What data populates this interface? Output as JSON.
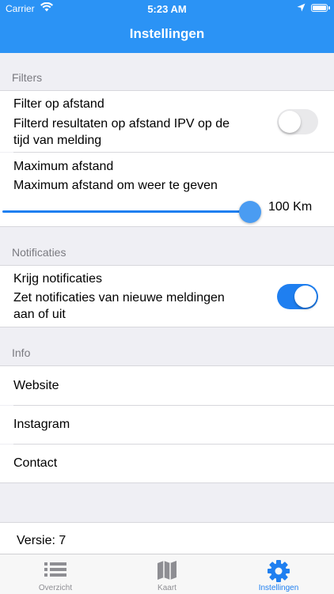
{
  "status_bar": {
    "carrier": "Carrier",
    "time": "5:23 AM"
  },
  "header": {
    "title": "Instellingen"
  },
  "filters": {
    "section_title": "Filters",
    "filter_distance": {
      "title": "Filter op afstand",
      "subtitle_line1": "Filterd resultaten op afstand IPV op de",
      "subtitle_line2": "tijd van melding",
      "enabled": false
    },
    "max_distance": {
      "title": "Maximum afstand",
      "subtitle": "Maximum afstand om weer te geven",
      "value_label": "100 Km",
      "slider_fraction": 1.0
    }
  },
  "notifications": {
    "section_title": "Notificaties",
    "receive": {
      "title": "Krijg notificaties",
      "subtitle_line1": "Zet notificaties van nieuwe meldingen",
      "subtitle_line2": "aan of uit",
      "enabled": true
    }
  },
  "info": {
    "section_title": "Info",
    "items": [
      "Website",
      "Instagram",
      "Contact"
    ]
  },
  "version": "Versie: 7",
  "tabbar": {
    "tabs": [
      {
        "label": "Overzicht",
        "icon": "list-icon",
        "active": false
      },
      {
        "label": "Kaart",
        "icon": "map-icon",
        "active": false
      },
      {
        "label": "Instellingen",
        "icon": "gear-icon",
        "active": true
      }
    ]
  },
  "colors": {
    "accent": "#2b93f5",
    "toggle_on": "#1f7ff0",
    "background": "#efeff4"
  }
}
